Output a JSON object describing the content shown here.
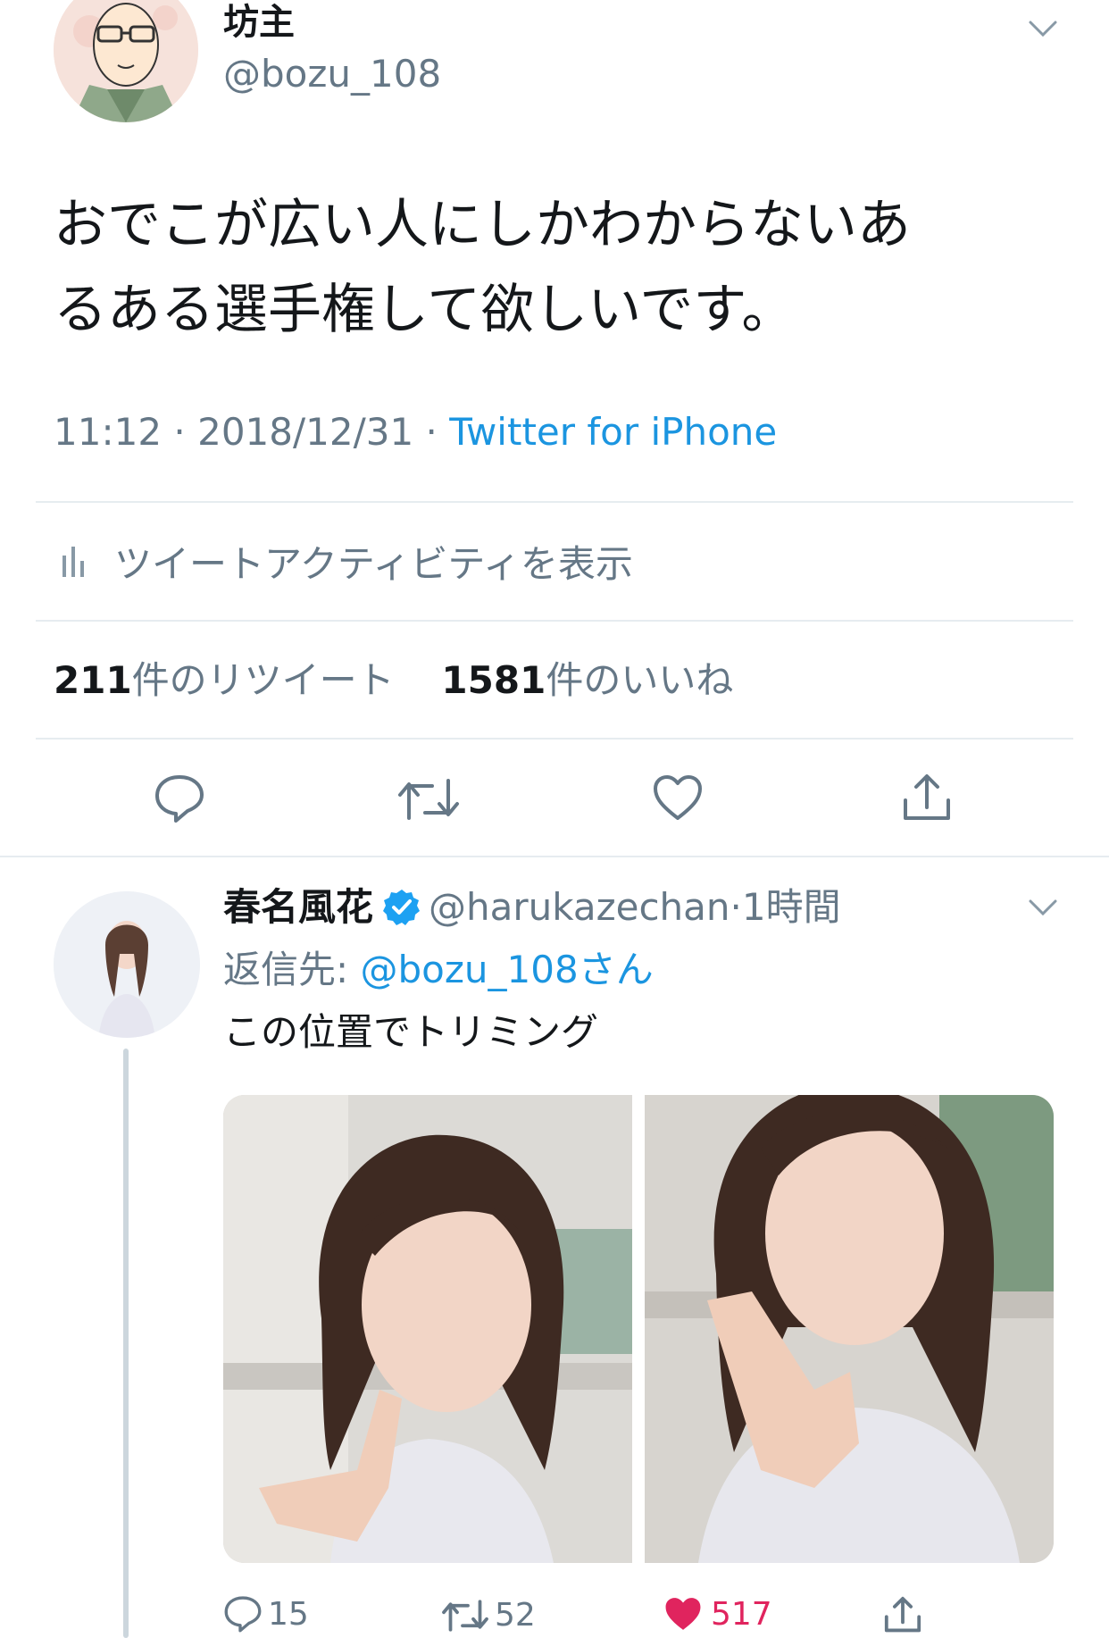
{
  "tweet": {
    "author_name": "坊主",
    "author_handle": "@bozu_108",
    "text_line1": "おでこが広い人にしかわからないあ",
    "text_line2": "るある選手権して欲しいです。",
    "time": "11:12",
    "date": "2018/12/31",
    "source": "Twitter for iPhone",
    "activity_label": "ツイートアクティビティを表示",
    "retweet_count": "211",
    "retweet_label": "件のリツイート",
    "like_count": "1581",
    "like_label": "件のいいね"
  },
  "reply": {
    "author_name": "春名風花",
    "author_handle": "@harukazechan",
    "time_ago": "1時間",
    "reply_to_prefix": "返信先: ",
    "reply_to_handle": "@bozu_108さん",
    "text": "この位置でトリミング",
    "reply_count": "15",
    "retweet_count": "52",
    "like_count": "517"
  },
  "colors": {
    "accent": "#1b95e0",
    "like": "#e0245e",
    "verified": "#1da1f2",
    "divider": "#e6ecf0",
    "gray": "#657786"
  },
  "icons": [
    "chevron-down-icon",
    "bar-chart-icon",
    "reply-icon",
    "retweet-icon",
    "heart-icon",
    "share-icon",
    "verified-badge-icon"
  ]
}
